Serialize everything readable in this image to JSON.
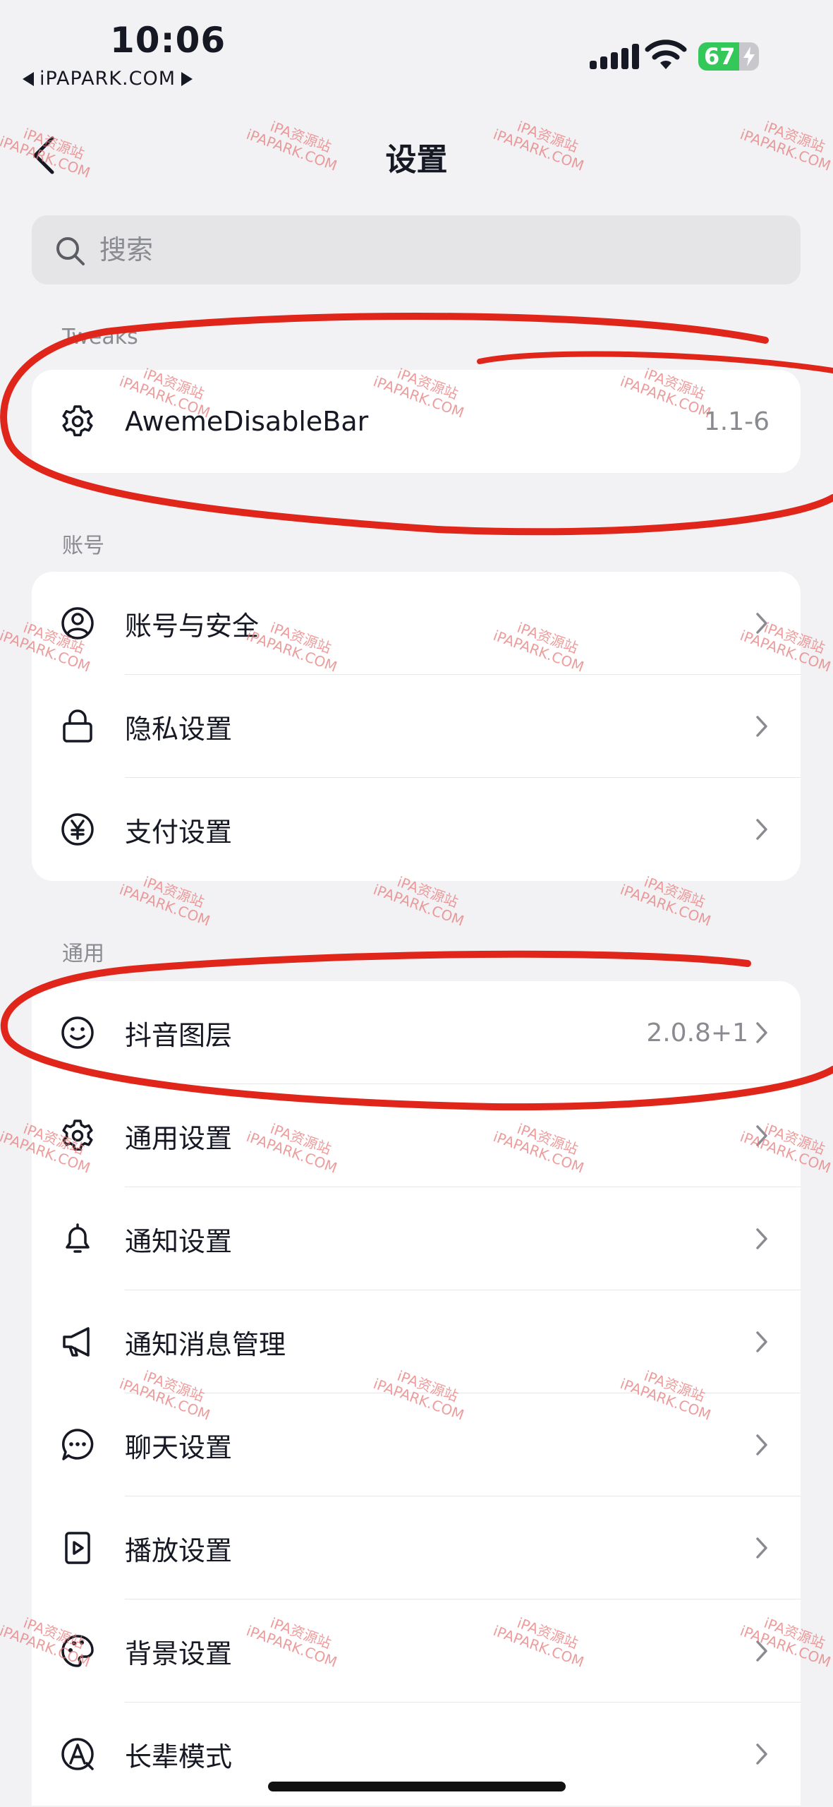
{
  "status_bar": {
    "time": "10:06",
    "carrier": "iPAPARK.COM",
    "battery": "67",
    "battery_level": 0.67
  },
  "nav": {
    "title": "设置"
  },
  "search": {
    "placeholder": "搜索"
  },
  "sections": {
    "tweaks": {
      "label": "Tweaks",
      "items": [
        {
          "label": "AwemeDisableBar",
          "value": "1.1-6",
          "icon": "gear-icon"
        }
      ]
    },
    "account": {
      "label": "账号",
      "items": [
        {
          "label": "账号与安全",
          "icon": "user-circle-icon"
        },
        {
          "label": "隐私设置",
          "icon": "lock-icon"
        },
        {
          "label": "支付设置",
          "icon": "yen-icon"
        }
      ]
    },
    "general": {
      "label": "通用",
      "items": [
        {
          "label": "抖音图层",
          "value": "2.0.8+1",
          "icon": "smiley-icon"
        },
        {
          "label": "通用设置",
          "icon": "gear-icon"
        },
        {
          "label": "通知设置",
          "icon": "bell-icon"
        },
        {
          "label": "通知消息管理",
          "icon": "megaphone-icon"
        },
        {
          "label": "聊天设置",
          "icon": "chat-bubble-icon"
        },
        {
          "label": "播放设置",
          "icon": "play-icon"
        },
        {
          "label": "背景设置",
          "icon": "palette-icon"
        },
        {
          "label": "长辈模式",
          "icon": "elder-mode-icon"
        }
      ]
    }
  },
  "watermark": {
    "line1": "iPA资源站",
    "line2": "iPAPARK.COM"
  },
  "colors": {
    "annotation": "#e0261b",
    "accent": "#161823",
    "secondary": "#8a8b91",
    "battery": "#34c759"
  }
}
